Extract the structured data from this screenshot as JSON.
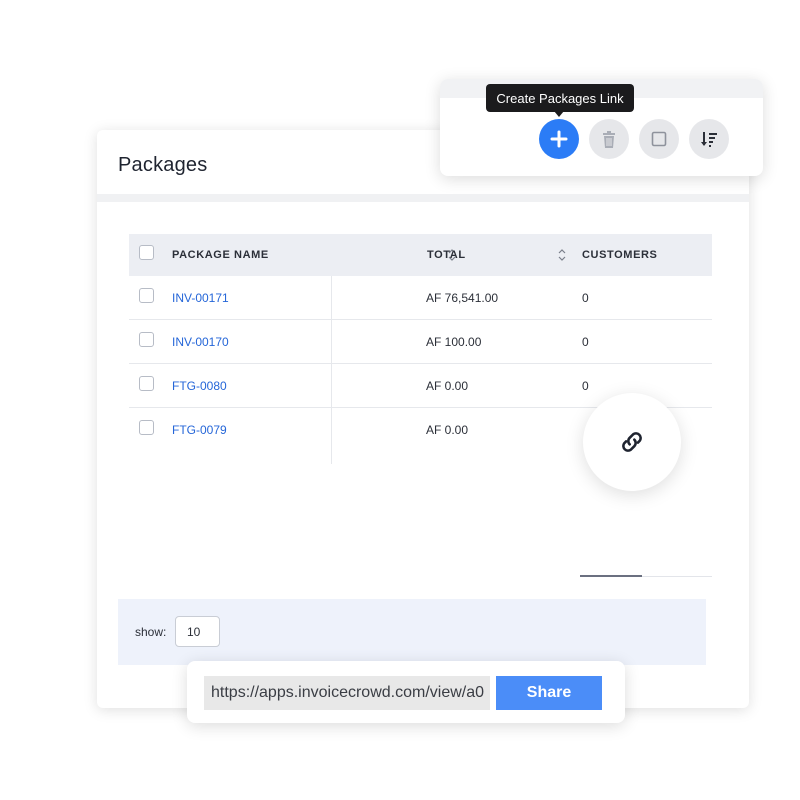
{
  "header": {
    "title": "Packages"
  },
  "toolbar": {
    "tooltip": "Create Packages Link",
    "buttons": [
      {
        "icon": "plus-icon",
        "active": true
      },
      {
        "icon": "trash-icon",
        "active": false
      },
      {
        "icon": "square-icon",
        "active": false
      },
      {
        "icon": "sort-icon",
        "active": false
      }
    ]
  },
  "table": {
    "columns": [
      "PACKAGE NAME",
      "TOTAL",
      "CUSTOMERS"
    ],
    "rows": [
      {
        "name": "INV-00171",
        "total": "AF 76,541.00",
        "customers": "0"
      },
      {
        "name": "INV-00170",
        "total": "AF 100.00",
        "customers": "0"
      },
      {
        "name": "FTG-0080",
        "total": "AF 0.00",
        "customers": "0"
      },
      {
        "name": "FTG-0079",
        "total": "AF 0.00",
        "customers": ""
      }
    ]
  },
  "footer": {
    "show_label": "show:",
    "page_size": "10"
  },
  "share": {
    "url": "https://apps.invoicecrowd.com/view/a0",
    "button_label": "Share"
  },
  "colors": {
    "accent": "#2b7cf6",
    "link": "#2566d8",
    "share_button": "#4b8df8"
  }
}
